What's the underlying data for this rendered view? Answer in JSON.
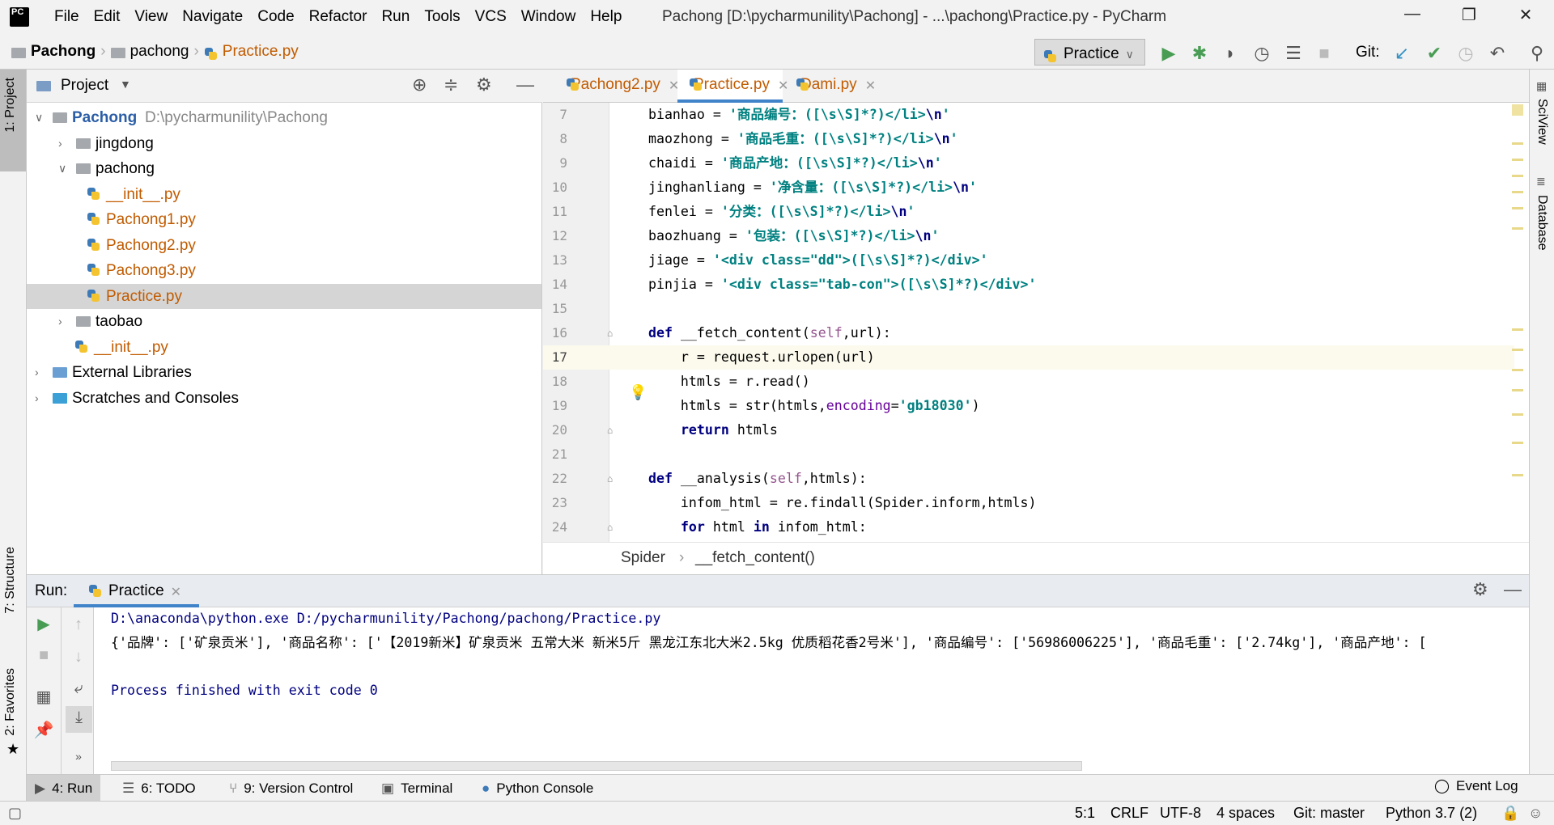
{
  "window": {
    "title": "Pachong [D:\\pycharmunility\\Pachong] - ...\\pachong\\Practice.py - PyCharm",
    "app_logo": "PC"
  },
  "menu": [
    "File",
    "Edit",
    "View",
    "Navigate",
    "Code",
    "Refactor",
    "Run",
    "Tools",
    "VCS",
    "Window",
    "Help"
  ],
  "nav": {
    "crumbs": [
      "Pachong",
      "pachong",
      "Practice.py"
    ],
    "run_config": "Practice",
    "git_label": "Git:"
  },
  "left_strip": {
    "project": "1: Project",
    "structure": "7: Structure",
    "favorites": "2: Favorites"
  },
  "right_strip": {
    "sciview": "SciView",
    "database": "Database"
  },
  "project": {
    "title": "Project",
    "tree": [
      {
        "label": "Pachong",
        "extra": "D:\\pycharmunility\\Pachong",
        "level": 0,
        "kind": "folder",
        "expanded": true,
        "bold": true
      },
      {
        "label": "jingdong",
        "level": 1,
        "kind": "folder",
        "expanded": false
      },
      {
        "label": "pachong",
        "level": 1,
        "kind": "folder",
        "expanded": true
      },
      {
        "label": "__init__.py",
        "level": 2,
        "kind": "py"
      },
      {
        "label": "Pachong1.py",
        "level": 2,
        "kind": "py"
      },
      {
        "label": "Pachong2.py",
        "level": 2,
        "kind": "py"
      },
      {
        "label": "Pachong3.py",
        "level": 2,
        "kind": "py"
      },
      {
        "label": "Practice.py",
        "level": 2,
        "kind": "py",
        "selected": true
      },
      {
        "label": "taobao",
        "level": 1,
        "kind": "folder",
        "expanded": false
      },
      {
        "label": "__init__.py",
        "level": 1,
        "kind": "py",
        "leaf": true
      },
      {
        "label": "External Libraries",
        "level": 0,
        "kind": "lib",
        "expanded": false
      },
      {
        "label": "Scratches and Consoles",
        "level": 0,
        "kind": "scratch",
        "expanded": false
      }
    ]
  },
  "editor": {
    "tabs": [
      {
        "label": "Pachong2.py"
      },
      {
        "label": "Practice.py",
        "active": true
      },
      {
        "label": "Dami.py"
      }
    ],
    "current_line": 17,
    "lines": [
      {
        "n": "7",
        "tokens": [
          {
            "t": "    bianhao = ",
            "c": "p"
          },
          {
            "t": "'商品编号：([\\s\\S]*?)</li>",
            "c": "s"
          },
          {
            "t": "\\n",
            "c": "e"
          },
          {
            "t": "'",
            "c": "s"
          }
        ]
      },
      {
        "n": "8",
        "tokens": [
          {
            "t": "    maozhong = ",
            "c": "p"
          },
          {
            "t": "'商品毛重：([\\s\\S]*?)</li>",
            "c": "s"
          },
          {
            "t": "\\n",
            "c": "e"
          },
          {
            "t": "'",
            "c": "s"
          }
        ]
      },
      {
        "n": "9",
        "tokens": [
          {
            "t": "    chaidi = ",
            "c": "p"
          },
          {
            "t": "'商品产地：([\\s\\S]*?)</li>",
            "c": "s"
          },
          {
            "t": "\\n",
            "c": "e"
          },
          {
            "t": "'",
            "c": "s"
          }
        ]
      },
      {
        "n": "10",
        "tokens": [
          {
            "t": "    jinghanliang = ",
            "c": "p"
          },
          {
            "t": "'净含量：([\\s\\S]*?)</li>",
            "c": "s"
          },
          {
            "t": "\\n",
            "c": "e"
          },
          {
            "t": "'",
            "c": "s"
          }
        ]
      },
      {
        "n": "11",
        "tokens": [
          {
            "t": "    fenlei = ",
            "c": "p"
          },
          {
            "t": "'分类：([\\s\\S]*?)</li>",
            "c": "s"
          },
          {
            "t": "\\n",
            "c": "e"
          },
          {
            "t": "'",
            "c": "s"
          }
        ]
      },
      {
        "n": "12",
        "tokens": [
          {
            "t": "    baozhuang = ",
            "c": "p"
          },
          {
            "t": "'包装：([\\s\\S]*?)</li>",
            "c": "s"
          },
          {
            "t": "\\n",
            "c": "e"
          },
          {
            "t": "'",
            "c": "s"
          }
        ]
      },
      {
        "n": "13",
        "tokens": [
          {
            "t": "    jiage = ",
            "c": "p"
          },
          {
            "t": "'<div class=\"dd\">([\\s\\S]*?)</div>'",
            "c": "s"
          }
        ]
      },
      {
        "n": "14",
        "tokens": [
          {
            "t": "    pinjia = ",
            "c": "p"
          },
          {
            "t": "'<div class=\"tab-con\">([\\s\\S]*?)</div>'",
            "c": "s"
          }
        ]
      },
      {
        "n": "15",
        "tokens": []
      },
      {
        "n": "16",
        "tokens": [
          {
            "t": "    ",
            "c": "p"
          },
          {
            "t": "def",
            "c": "k"
          },
          {
            "t": " __fetch_content(",
            "c": "p"
          },
          {
            "t": "self",
            "c": "sf"
          },
          {
            "t": ",url):",
            "c": "p"
          }
        ]
      },
      {
        "n": "17",
        "tokens": [
          {
            "t": "        r = request.urlopen(url)",
            "c": "p"
          }
        ]
      },
      {
        "n": "18",
        "tokens": [
          {
            "t": "        htmls = r.read()",
            "c": "p"
          }
        ]
      },
      {
        "n": "19",
        "tokens": [
          {
            "t": "        htmls = str(htmls,",
            "c": "p"
          },
          {
            "t": "encoding",
            "c": "kw"
          },
          {
            "t": "=",
            "c": "p"
          },
          {
            "t": "'gb18030'",
            "c": "s"
          },
          {
            "t": ")",
            "c": "p"
          }
        ]
      },
      {
        "n": "20",
        "tokens": [
          {
            "t": "        ",
            "c": "p"
          },
          {
            "t": "return",
            "c": "k"
          },
          {
            "t": " htmls",
            "c": "p"
          }
        ]
      },
      {
        "n": "21",
        "tokens": []
      },
      {
        "n": "22",
        "tokens": [
          {
            "t": "    ",
            "c": "p"
          },
          {
            "t": "def",
            "c": "k"
          },
          {
            "t": " __analysis(",
            "c": "p"
          },
          {
            "t": "self",
            "c": "sf"
          },
          {
            "t": ",htmls):",
            "c": "p"
          }
        ]
      },
      {
        "n": "23",
        "tokens": [
          {
            "t": "        infom_html = re.findall(Spider.inform,htmls)",
            "c": "p"
          }
        ]
      },
      {
        "n": "24",
        "tokens": [
          {
            "t": "        ",
            "c": "p"
          },
          {
            "t": "for",
            "c": "k"
          },
          {
            "t": " html ",
            "c": "p"
          },
          {
            "t": "in",
            "c": "k"
          },
          {
            "t": " infom_html:",
            "c": "p"
          }
        ]
      }
    ],
    "breadcrumb": [
      "Spider",
      "__fetch_content()"
    ]
  },
  "run": {
    "label": "Run:",
    "tab": "Practice",
    "output": [
      "D:\\anaconda\\python.exe D:/pycharmunility/Pachong/pachong/Practice.py",
      "{'品牌': ['矿泉贡米'], '商品名称': ['【2019新米】矿泉贡米 五常大米 新米5斤 黑龙江东北大米2.5kg 优质稻花香2号米'], '商品编号': ['56986006225'], '商品毛重': ['2.74kg'], '商品产地': [",
      "",
      "Process finished with exit code 0"
    ]
  },
  "bottom_tabs": [
    {
      "label": "4: Run",
      "icon": "play-icon",
      "active": true
    },
    {
      "label": "6: TODO",
      "icon": "list-icon"
    },
    {
      "label": "9: Version Control",
      "icon": "branch-icon"
    },
    {
      "label": "Terminal",
      "icon": "terminal-icon"
    },
    {
      "label": "Python Console",
      "icon": "python-icon"
    }
  ],
  "event_log": "Event Log",
  "status": {
    "position": "5:1",
    "line_sep": "CRLF",
    "encoding": "UTF-8",
    "indent": "4 spaces",
    "git": "Git: master",
    "interpreter": "Python 3.7 (2)"
  },
  "colors": {
    "accent": "#4083c9",
    "keyword": "#000080",
    "string": "#008080",
    "self": "#94558d",
    "run_green": "#499c54",
    "selected_file": "#c15b00"
  }
}
